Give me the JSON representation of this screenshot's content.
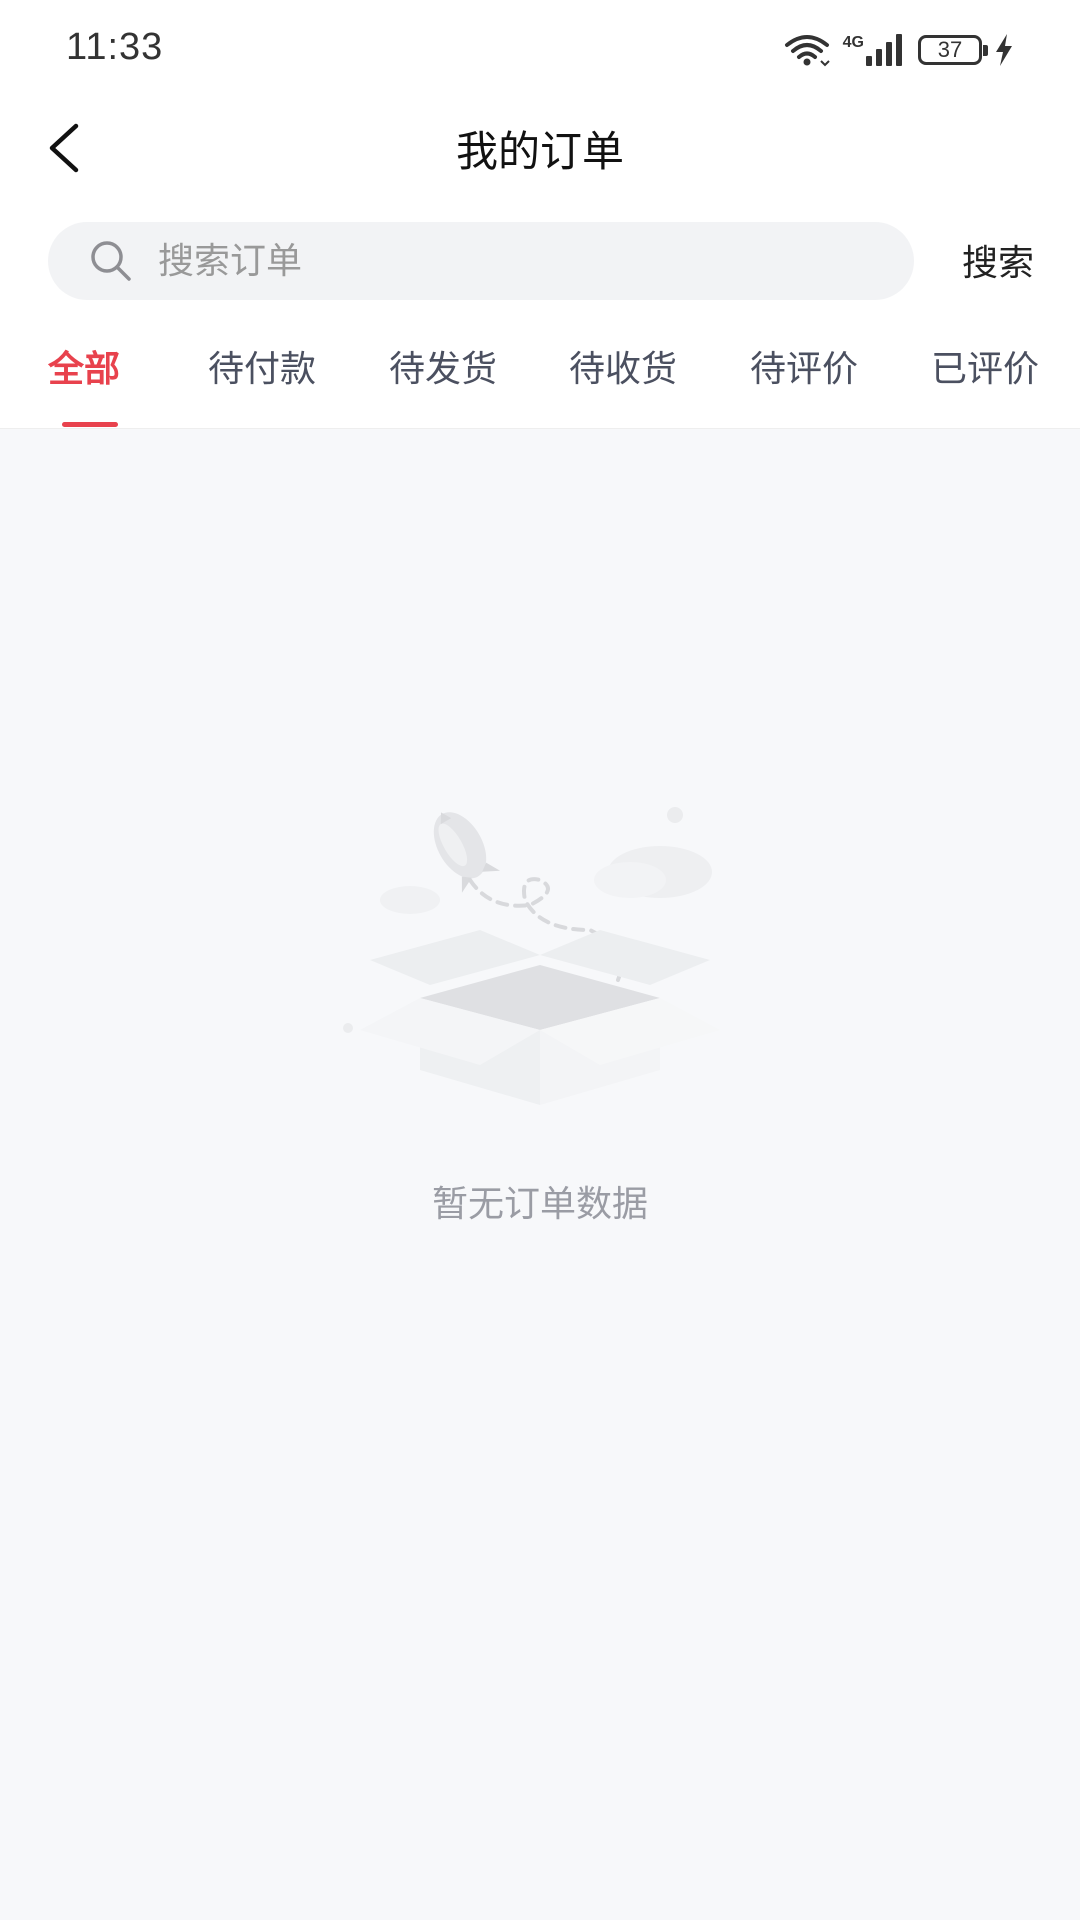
{
  "status_bar": {
    "time": "11:33",
    "network": "4G",
    "battery": "37",
    "icons": [
      "wifi-icon",
      "signal-icon",
      "battery-icon",
      "charging-icon"
    ]
  },
  "header": {
    "back_icon": "chevron-left-icon",
    "title": "我的订单"
  },
  "search": {
    "placeholder": "搜索订单",
    "value": "",
    "icon": "search-icon",
    "button_label": "搜索"
  },
  "tabs": [
    {
      "label": "全部",
      "active": true
    },
    {
      "label": "待付款",
      "active": false
    },
    {
      "label": "待发货",
      "active": false
    },
    {
      "label": "待收货",
      "active": false
    },
    {
      "label": "待评价",
      "active": false
    },
    {
      "label": "已评价",
      "active": false
    }
  ],
  "empty_state": {
    "illustration": "empty-box-icon",
    "message": "暂无订单数据"
  },
  "colors": {
    "accent": "#e8424d",
    "background": "#f7f8fa",
    "search_bg": "#f2f3f5",
    "tab_text": "#4b5060",
    "muted_text": "#9a9ca4"
  }
}
